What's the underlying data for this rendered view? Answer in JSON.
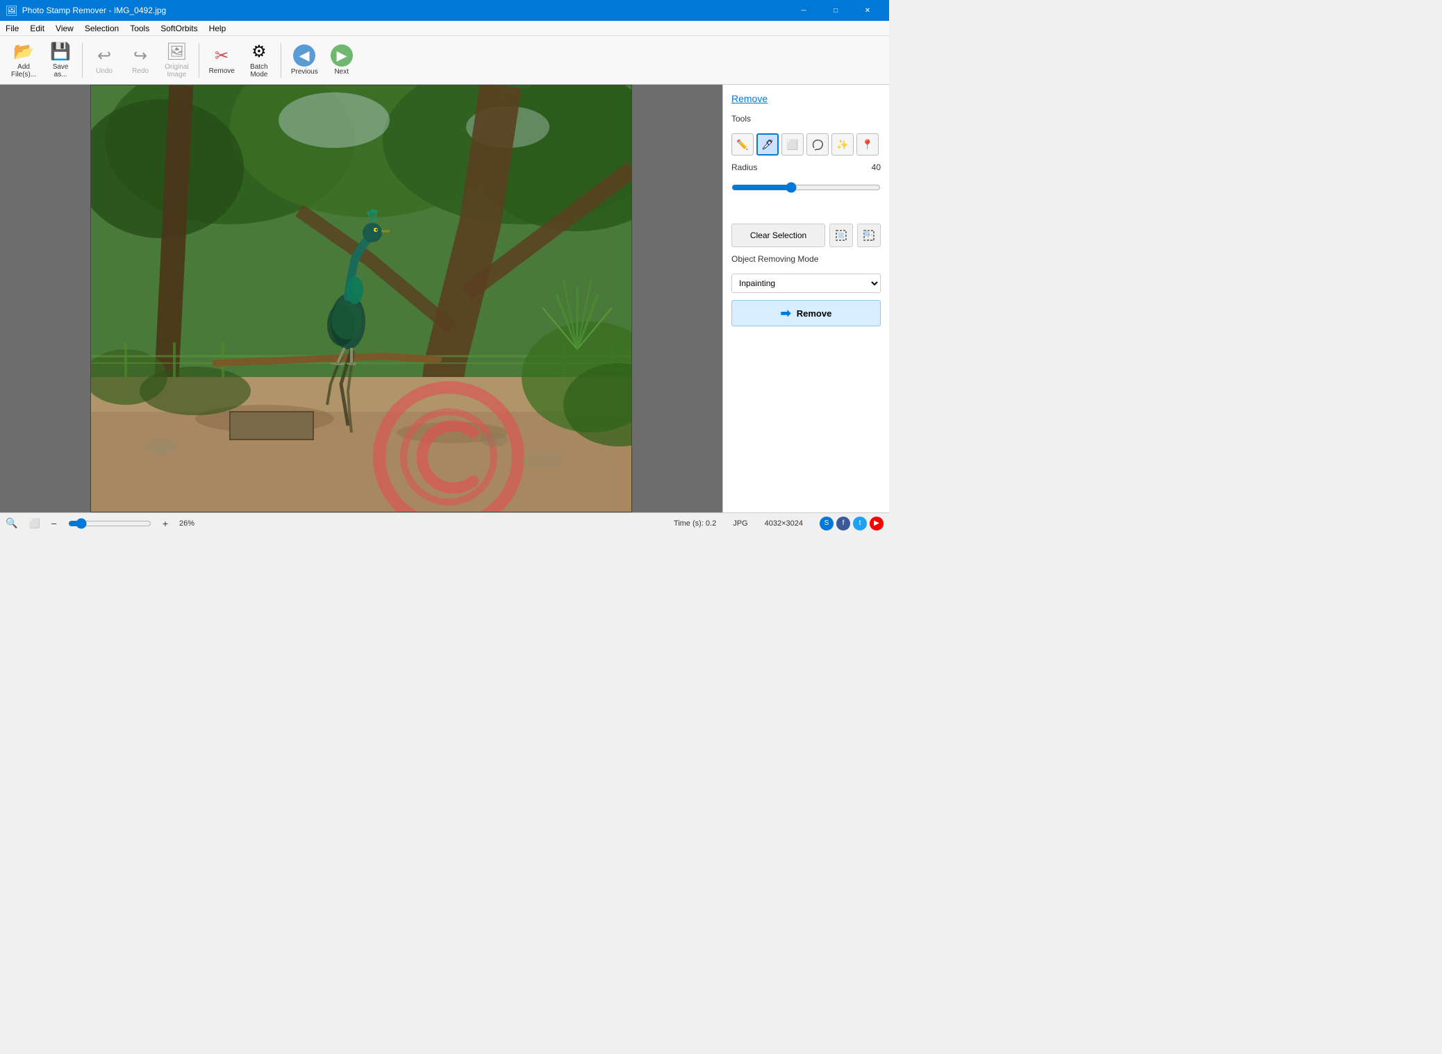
{
  "window": {
    "title": "Photo Stamp Remover - IMG_0492.jpg",
    "icon": "🖼"
  },
  "titlebar": {
    "minimize": "─",
    "maximize": "□",
    "close": "✕"
  },
  "menu": {
    "items": [
      "File",
      "Edit",
      "View",
      "Selection",
      "Tools",
      "SoftOrbits",
      "Help"
    ]
  },
  "toolbar": {
    "add_files_label": "Add\nFile(s)...",
    "save_as_label": "Save\nas...",
    "undo_label": "Undo",
    "redo_label": "Redo",
    "original_image_label": "Original\nImage",
    "remove_label": "Remove",
    "batch_mode_label": "Batch\nMode",
    "previous_label": "Previous",
    "next_label": "Next"
  },
  "right_panel": {
    "section_title": "Remove",
    "tools_label": "Tools",
    "tool_items": [
      {
        "name": "brush-tool",
        "icon": "✏️",
        "active": false
      },
      {
        "name": "marker-tool",
        "icon": "🖊",
        "active": true
      },
      {
        "name": "rect-tool",
        "icon": "⬜",
        "active": false
      },
      {
        "name": "lasso-tool",
        "icon": "🪢",
        "active": false
      },
      {
        "name": "magic-wand-tool",
        "icon": "✨",
        "active": false
      },
      {
        "name": "stamp-tool",
        "icon": "📍",
        "active": false
      }
    ],
    "radius_label": "Radius",
    "radius_value": "40",
    "clear_selection_label": "Clear Selection",
    "object_removing_mode_label": "Object Removing Mode",
    "inpainting_option": "Inpainting",
    "remove_button_label": "Remove"
  },
  "status_bar": {
    "zoom_label": "26%",
    "time_label": "Time (s): 0.2",
    "file_format": "JPG",
    "dimensions": "4032×3024"
  }
}
